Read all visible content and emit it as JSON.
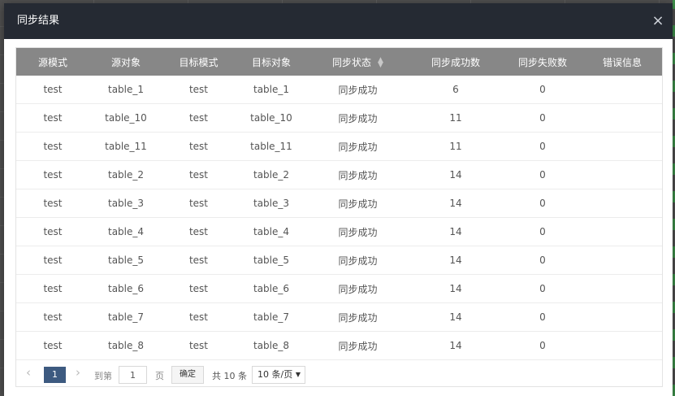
{
  "modal": {
    "title": "同步结果",
    "close_label": "×"
  },
  "table": {
    "columns": [
      "源模式",
      "源对象",
      "目标模式",
      "目标对象",
      "同步状态",
      "同步成功数",
      "同步失败数",
      "错误信息"
    ],
    "sort_icon": "sort-icon",
    "rows": [
      [
        "test",
        "table_1",
        "test",
        "table_1",
        "同步成功",
        "6",
        "0",
        ""
      ],
      [
        "test",
        "table_10",
        "test",
        "table_10",
        "同步成功",
        "11",
        "0",
        ""
      ],
      [
        "test",
        "table_11",
        "test",
        "table_11",
        "同步成功",
        "11",
        "0",
        ""
      ],
      [
        "test",
        "table_2",
        "test",
        "table_2",
        "同步成功",
        "14",
        "0",
        ""
      ],
      [
        "test",
        "table_3",
        "test",
        "table_3",
        "同步成功",
        "14",
        "0",
        ""
      ],
      [
        "test",
        "table_4",
        "test",
        "table_4",
        "同步成功",
        "14",
        "0",
        ""
      ],
      [
        "test",
        "table_5",
        "test",
        "table_5",
        "同步成功",
        "14",
        "0",
        ""
      ],
      [
        "test",
        "table_6",
        "test",
        "table_6",
        "同步成功",
        "14",
        "0",
        ""
      ],
      [
        "test",
        "table_7",
        "test",
        "table_7",
        "同步成功",
        "14",
        "0",
        ""
      ],
      [
        "test",
        "table_8",
        "test",
        "table_8",
        "同步成功",
        "14",
        "0",
        ""
      ]
    ]
  },
  "pager": {
    "prev_label": "‹",
    "current_page": "1",
    "next_label": "›",
    "goto_label": "到第",
    "goto_value": "1",
    "page_label": "页",
    "confirm_label": "确定",
    "total_label": "共 10 条",
    "page_size_label": "10 条/页",
    "page_size_caret": "▼"
  },
  "colors": {
    "header_bg": "#252a33",
    "table_header_bg": "#878787",
    "pager_active": "#3d5a80"
  }
}
